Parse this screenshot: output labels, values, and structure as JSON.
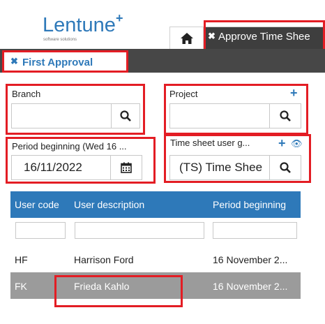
{
  "brand": {
    "name": "Lentune",
    "plus": "+",
    "tagline": "software solutions"
  },
  "tabs": {
    "home_icon": "home-icon",
    "active_close": "✖",
    "active_label": "Approve Time Shee"
  },
  "subtab": {
    "close": "✖",
    "label": "First Approval"
  },
  "fields": {
    "branch": {
      "label": "Branch",
      "value": ""
    },
    "project": {
      "label": "Project",
      "value": "",
      "add": "+"
    },
    "period": {
      "label": "Period beginning (Wed 16 ...",
      "value": "16/11/2022"
    },
    "ts_user": {
      "label": "Time sheet user g...",
      "value": "(TS) Time Shee",
      "add": "+",
      "view": "👁"
    }
  },
  "table": {
    "columns": [
      "User code",
      "User description",
      "Period beginning"
    ],
    "rows": [
      {
        "code": "HF",
        "description": "Harrison Ford",
        "period": "16 November 2..."
      },
      {
        "code": "FK",
        "description": "Frieda Kahlo",
        "period": "16 November 2..."
      }
    ]
  },
  "colors": {
    "accent": "#2e79b9",
    "highlight": "#e31d24",
    "dark_bar": "#474747",
    "selected_row": "#9b9b9b"
  }
}
